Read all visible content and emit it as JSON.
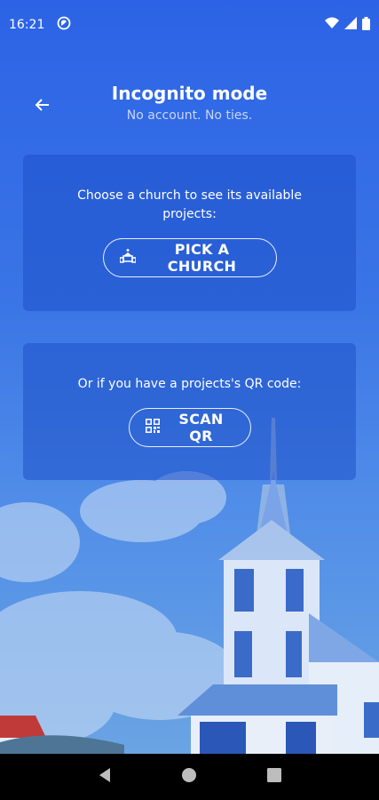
{
  "status": {
    "time": "16:21"
  },
  "header": {
    "title": "Incognito mode",
    "subtitle": "No account. No ties."
  },
  "church_card": {
    "text": "Choose a church to see its available projects:",
    "button": "PICK A CHURCH"
  },
  "qr_card": {
    "text": "Or if you have a projects's QR code:",
    "button": "SCAN QR"
  },
  "colors": {
    "accent": "#2f66e0",
    "card": "#2a5fd0",
    "navbar": "#000000"
  }
}
